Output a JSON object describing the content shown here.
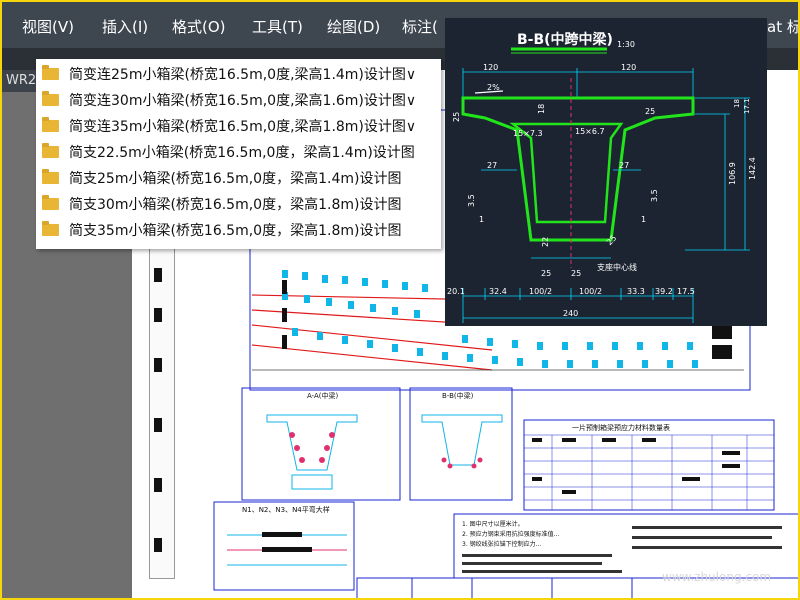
{
  "menu": {
    "items": [
      "视图(V)",
      "插入(I)",
      "格式(O)",
      "工具(T)",
      "绘图(D)",
      "标注(",
      "at 标"
    ]
  },
  "tab": {
    "label": "WR2"
  },
  "folders": [
    "简变连25m小箱梁(桥宽16.5m,0度,梁高1.4m)设计图∨",
    "简变连30m小箱梁(桥宽16.5m,0度,梁高1.6m)设计图∨",
    "简变连35m小箱梁(桥宽16.5m,0度,梁高1.8m)设计图∨",
    "简支22.5m小箱梁(桥宽16.5m,0度，梁高1.4m)设计图",
    "简支25m小箱梁(桥宽16.5m,0度，梁高1.4m)设计图",
    "简支30m小箱梁(桥宽16.5m,0度，梁高1.8m)设计图",
    "简支35m小箱梁(桥宽16.5m,0度，梁高1.8m)设计图"
  ],
  "cad": {
    "title": "B-B(中跨中梁)",
    "scale": "1:30",
    "dims": {
      "top_left": "120",
      "top_right": "120",
      "slope": "2%",
      "d18": "18",
      "d25a": "25",
      "d25b": "25",
      "d25c": "25",
      "chamfer_left": "15×7.3",
      "chamfer_right": "15×6.7",
      "d27a": "27",
      "d27b": "27",
      "ratio_left": "3.5",
      "ratio_left_1": "1",
      "ratio_right": "3.5",
      "ratio_right_1": "1",
      "d22": "22",
      "d25bot": "25",
      "d25bot2": "25",
      "d25r": "25",
      "h_total": "142.4",
      "h_inner": "106.9",
      "h_small1": "18",
      "h_small2": "17.1",
      "support_line": "支座中心线",
      "b1": "20.1",
      "b2": "32.4",
      "b3": "100/2",
      "b4": "100/2",
      "b5": "33.3",
      "b6": "39.2",
      "b7": "17.5",
      "total_width": "240"
    }
  },
  "sheet": {
    "section_aa": "A-A(中梁)",
    "section_bb": "B-B(中梁)",
    "plan_label": "N1、N2、N3、N4平弯大样",
    "table_title": "一片预制箱梁预应力材料数量表",
    "notes_1": "1. 图中尺寸以厘米计。",
    "notes_2": "2. 预应力钢束采用抗拉强度标准值...",
    "notes_3": "3. 钢绞线张拉锚下控制应力..."
  },
  "colors": {
    "accent": "#22e41a",
    "dim_cyan": "#00d7ff",
    "frame_yellow": "#f5d60a",
    "cad_bg": "#1c2432",
    "menu_bg": "#3e4650"
  },
  "watermark": {
    "text": "www.zhulong.com"
  }
}
